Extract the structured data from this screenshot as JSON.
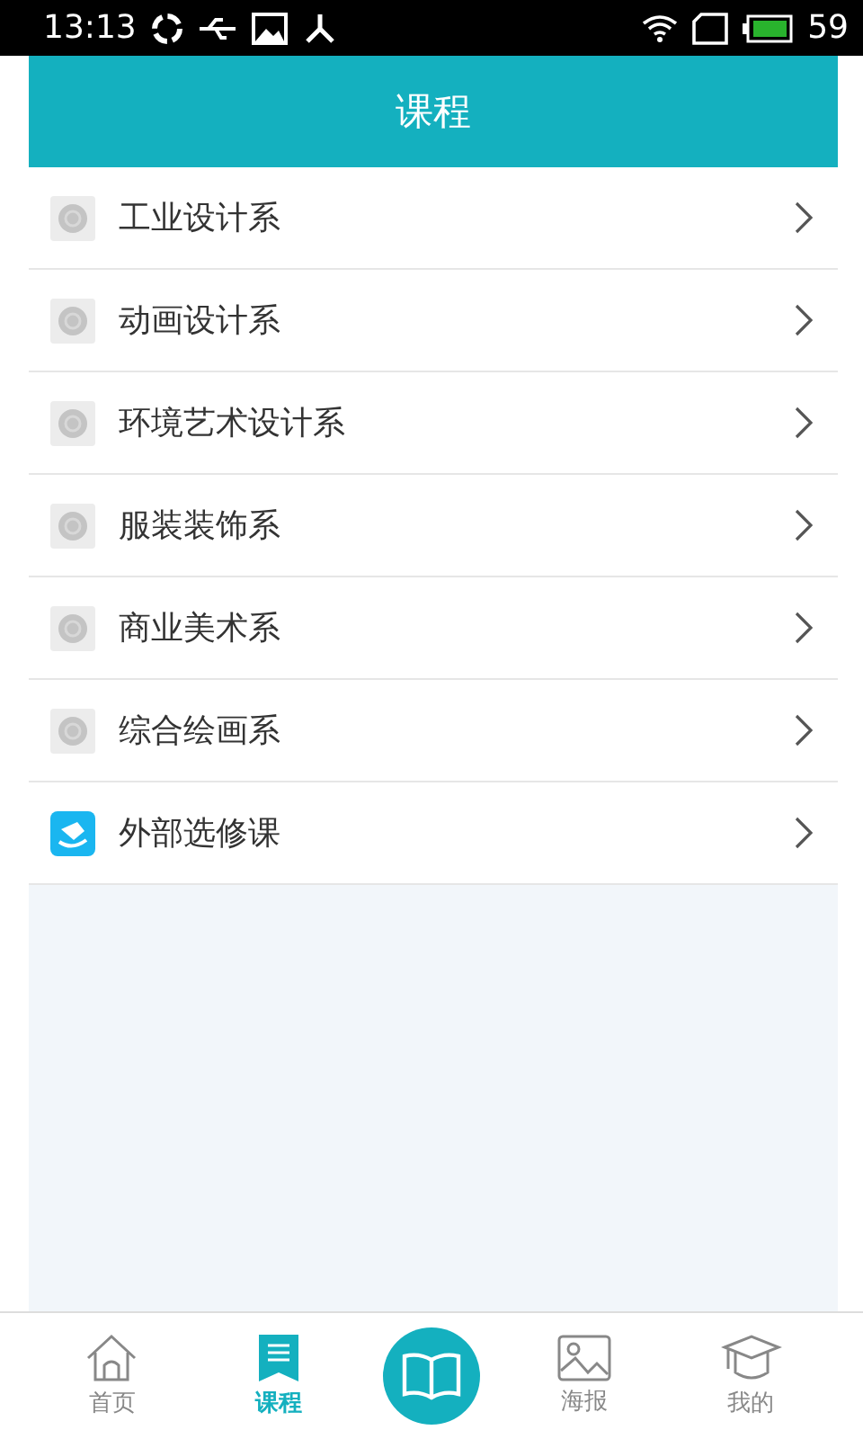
{
  "status_bar": {
    "time": "13:13",
    "battery": "59"
  },
  "header": {
    "title": "课程"
  },
  "courses": [
    {
      "label": "工业设计系",
      "kind": "department"
    },
    {
      "label": "动画设计系",
      "kind": "department"
    },
    {
      "label": "环境艺术设计系",
      "kind": "department"
    },
    {
      "label": "服装装饰系",
      "kind": "department"
    },
    {
      "label": "商业美术系",
      "kind": "department"
    },
    {
      "label": "综合绘画系",
      "kind": "department"
    },
    {
      "label": "外部选修课",
      "kind": "external"
    }
  ],
  "tab_bar": [
    {
      "label": "首页",
      "kind": "home",
      "selected": false
    },
    {
      "label": "课程",
      "kind": "courses",
      "selected": true
    },
    {
      "kind": "book",
      "selected": false
    },
    {
      "label": "海报",
      "kind": "poster",
      "selected": false
    },
    {
      "label": "我的",
      "kind": "profile",
      "selected": false
    }
  ]
}
